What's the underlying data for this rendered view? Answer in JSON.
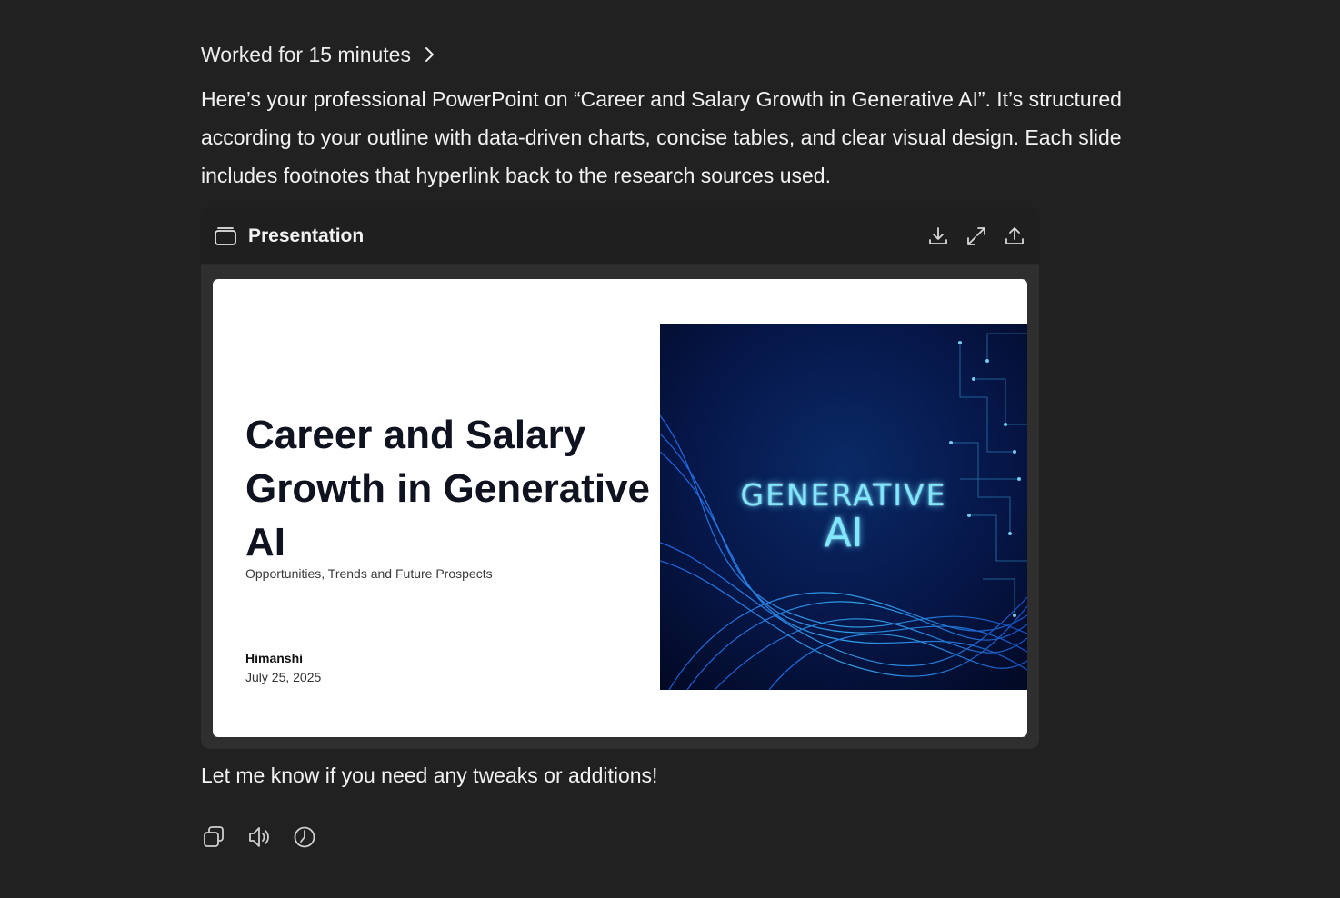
{
  "message": {
    "worked_label": "Worked for 15 minutes",
    "body": "Here’s your professional PowerPoint on “Career and Salary Growth in Generative AI”. It’s structured according to your outline with data-driven charts, concise tables, and clear visual design. Each slide includes footnotes that hyperlink back to the research sources used.",
    "followup": "Let me know if you need any tweaks or additions!"
  },
  "card": {
    "title": "Presentation",
    "icons": [
      "slides-icon",
      "download-icon",
      "expand-icon",
      "share-icon"
    ]
  },
  "slide": {
    "title": "Career and Salary Growth in Generative AI",
    "subtitle": "Opportunities, Trends and Future Prospects",
    "author": "Himanshi",
    "date": "July 25, 2025",
    "image_text_line1": "GENERATIVE",
    "image_text_line2": "AI"
  },
  "actions": {
    "icons": [
      "copy-icon",
      "read-aloud-icon",
      "history-icon"
    ]
  },
  "colors": {
    "background": "#212121",
    "card_header": "#1f1f1f",
    "card_body": "#2f2f2f",
    "slide_bg": "#ffffff",
    "image_glow": "#7fe8ff"
  }
}
